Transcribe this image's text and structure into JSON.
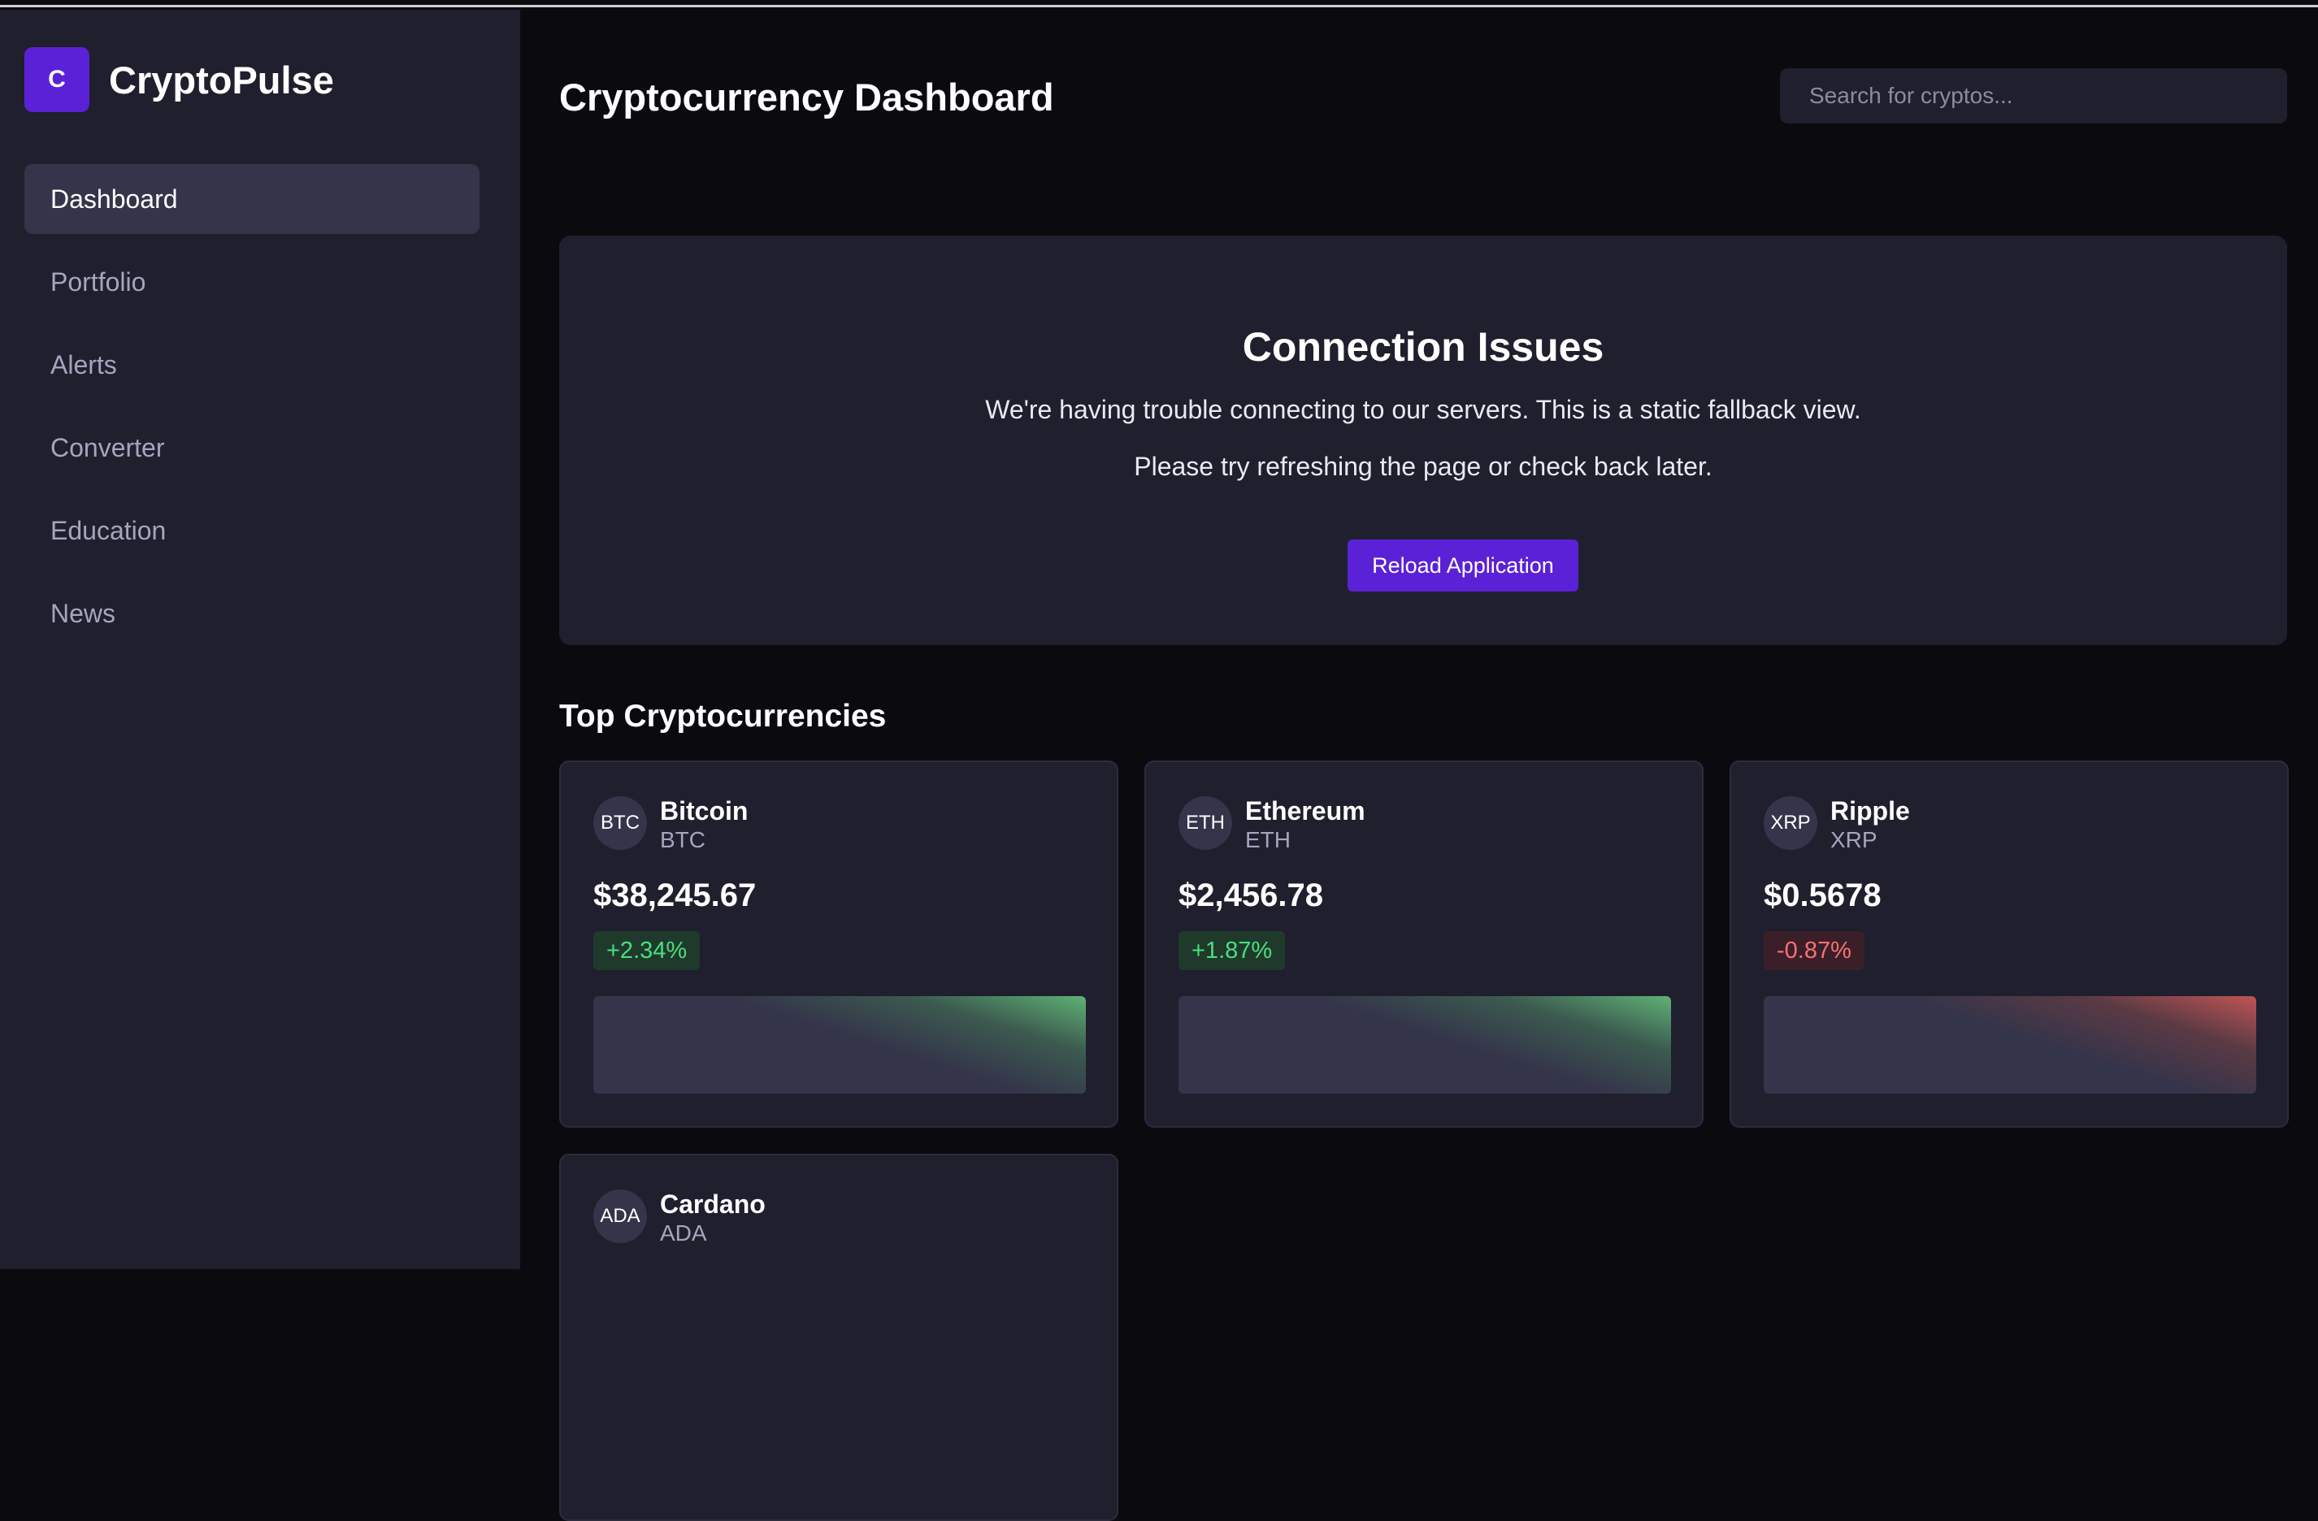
{
  "app": {
    "logo_letter": "C",
    "name": "CryptoPulse"
  },
  "sidebar": {
    "items": [
      {
        "label": "Dashboard",
        "active": true
      },
      {
        "label": "Portfolio"
      },
      {
        "label": "Alerts"
      },
      {
        "label": "Converter"
      },
      {
        "label": "Education"
      },
      {
        "label": "News"
      }
    ]
  },
  "header": {
    "title": "Cryptocurrency Dashboard",
    "search_placeholder": "Search for cryptos..."
  },
  "alert": {
    "title": "Connection Issues",
    "message1": "We're having trouble connecting to our servers. This is a static fallback view.",
    "message2": "Please try refreshing the page or check back later.",
    "button_label": "Reload Application"
  },
  "top_cryptos": {
    "title": "Top Cryptocurrencies",
    "coins": [
      {
        "icon": "BTC",
        "name": "Bitcoin",
        "symbol": "BTC",
        "price": "$38,245.67",
        "change": "+2.34%",
        "trend": "up"
      },
      {
        "icon": "ETH",
        "name": "Ethereum",
        "symbol": "ETH",
        "price": "$2,456.78",
        "change": "+1.87%",
        "trend": "up"
      },
      {
        "icon": "XRP",
        "name": "Ripple",
        "symbol": "XRP",
        "price": "$0.5678",
        "change": "-0.87%",
        "trend": "down"
      },
      {
        "icon": "ADA",
        "name": "Cardano",
        "symbol": "ADA"
      }
    ]
  },
  "colors": {
    "accent": "#5b21d6",
    "up": "#4ade80",
    "down": "#f87171",
    "panel": "#1f1f2e"
  }
}
